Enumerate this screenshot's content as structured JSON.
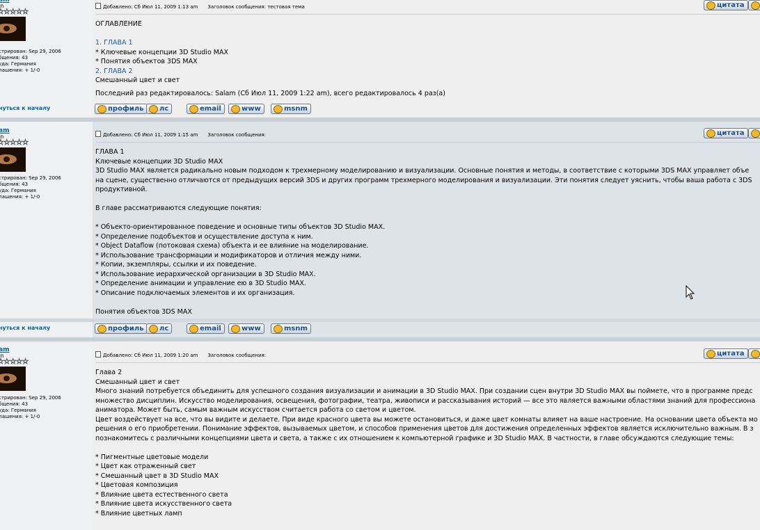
{
  "posts": [
    {
      "author": {
        "name": "am",
        "rank": "in",
        "stars": "☆☆☆☆☆",
        "registered": "стрирован: Sep 29, 2006",
        "messages": "бщения: 43",
        "location": "уда: Германия",
        "warnings": "пашения: + 1/-0"
      },
      "meta": {
        "added": "Добавлено: Сб Июл 11, 2009 1:13 am",
        "subject": "Заголовок сообщения: тестовая тема"
      },
      "quote_label": "цитата",
      "lines": [
        "ОГЛАВЛЕНИЕ",
        "",
        "1. ГЛАВА 1",
        "* Ключевые концепции 3D Studio MAX",
        "* Понятия объектов 3DS MAX",
        "2. ГЛАВА 2",
        "Смешанный цвет и свет"
      ],
      "edit_note": "Последний раз редактировалось: Salam (Сб Июл 11, 2009 1:22 am), всего редактировалось 4 раз(а)"
    },
    {
      "author": {
        "name": "am",
        "rank": "in",
        "stars": "☆☆☆☆☆",
        "registered": "стрирован: Sep 29, 2006",
        "messages": "бщения: 43",
        "location": "уда: Германия",
        "warnings": "пашения: + 1/-0"
      },
      "meta": {
        "added": "Добавлено: Сб Июл 11, 2009 1:15 am",
        "subject": "Заголовок сообщения:"
      },
      "quote_label": "цитата",
      "lines": [
        "ГЛАВА 1",
        "Ключевые концепции 3D Studio MAX",
        "3D Studio MAX является радикально новым подходом к трехмерному моделированию и визуализации. Основные понятия и методы, в соответствие с которыми 3DS MAX управляет объе",
        "на сцене, существенно отличаются от предыдущих версий 3DS и других программ трехмерного моделирования и визуализации. Эти понятия следует уяснить, чтобы ваша работа с 3DS",
        "продуктивной.",
        "",
        "В главе рассматриваются следующие понятия:",
        "",
        "* Объекто-ориентированное поведение и основные типы объектов 3D Studio MAX.",
        "* Определение подобъектов и осуществление доступа к ним.",
        "* Object Dataflow (потоковая схема) объекта и ее влияние на моделирование.",
        "* Использование трансформации и модификаторов и отличия между ними.",
        "* Копии, экземпляры, ссылки и их поведение.",
        "* Использование иерархической организации в 3D Studio MAX.",
        "* Определение анимации и управление ею в 3D Studio MAX.",
        "* Описание подключаемых элементов и их организация.",
        "",
        "Понятия объектов 3DS MAX"
      ]
    },
    {
      "author": {
        "name": "am",
        "rank": "in",
        "stars": "☆☆☆☆☆",
        "registered": "стрирован: Sep 29, 2006",
        "messages": "бщения: 43",
        "location": "уда: Германия",
        "warnings": "пашения: + 1/-0"
      },
      "meta": {
        "added": "Добавлено: Сб Июл 11, 2009 1:20 am",
        "subject": "Заголовок сообщения:"
      },
      "quote_label": "цитата",
      "lines": [
        "Глава 2",
        "Смешанный цвет и свет",
        "Много знаний потребуется объединить для успешного создания визуализации и анимации в 3D Studio MAX. При создании сцен внутри 3D Studio MAX вы поймете, что в программе предс",
        "множество дисциплин. Искусство моделирования, освещения, фотографии, театра, живописи и рассказывания историй — все это является важными областями знаний для профессиона",
        "аниматора. Может быть, самым важным искусством считается работа со светом и цветом.",
        "Цвет воздействует на все, что вы видите и делаете. При виде красного цвета вы можете остановиться, и даже цвет комнаты влияет на ваше настроение. На основании цвета объекта мо",
        "решения о его приобретении. Понимание эффектов, вызываемых цветом, и способов применения цветов для достижения определенных эффектов является исключительно важным. В з",
        "познакомитесь с различными концепциями цвета и света, а также с их отношением к компьютерной графике и 3D Studio MAX. В частности, в главе обсуждаются следующие темы:",
        "",
        "* Пигментные цветовые модели",
        "* Цвет как отраженный свет",
        "* Смешанный цвет в 3D Studio MAX",
        "* Цветовая композиция",
        "* Влияние цвета естественного света",
        "* Влияние цвета искусственного света",
        "* Влияние цветных ламп"
      ]
    }
  ],
  "footer": {
    "back_to_top": "нуться к началу",
    "profile": "профиль",
    "pm": "лс",
    "email": "email",
    "www": "www",
    "msnm": "msnm"
  }
}
